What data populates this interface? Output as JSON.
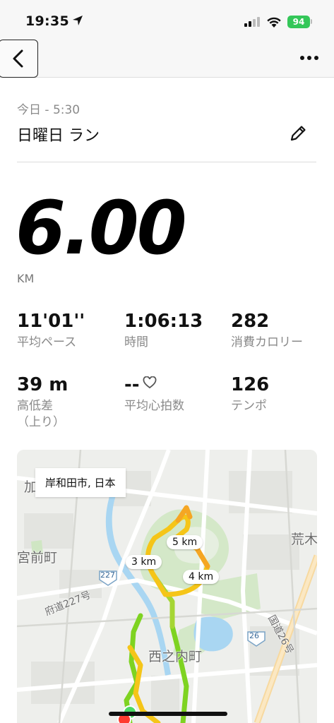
{
  "status_bar": {
    "time": "19:35",
    "battery": "94",
    "icons": [
      "location-arrow-icon",
      "signal-icon",
      "wifi-icon",
      "battery-icon"
    ]
  },
  "nav": {
    "back_icon": "chevron-left-icon",
    "more_icon": "ellipsis-icon"
  },
  "header": {
    "date": "今日 - 5:30",
    "title": "日曜日 ラン",
    "edit_icon": "pencil-icon"
  },
  "summary": {
    "distance": "6.00",
    "unit": "KM"
  },
  "stats": [
    {
      "value": "11'01''",
      "label": "平均ペース"
    },
    {
      "value": "1:06:13",
      "label": "時間"
    },
    {
      "value": "282",
      "label": "消費カロリー"
    },
    {
      "value": "39 m",
      "label": "高低差",
      "label2": "（上り）"
    },
    {
      "value": "--",
      "label": "平均心拍数"
    },
    {
      "value": "126",
      "label": "テンポ"
    }
  ],
  "map": {
    "location": "岸和田市, 日本",
    "km_markers": [
      "5 km",
      "3 km",
      "4 km"
    ],
    "labels": [
      "宮前町",
      "荒木",
      "西之内町",
      "府道227号",
      "国道26号",
      "227",
      "26",
      "加"
    ],
    "colors": {
      "route_green": "#7ed321",
      "route_yellow": "#f5c518",
      "route_orange": "#f5a623",
      "water": "#a9d6f2",
      "park": "#d4e8c8"
    }
  }
}
